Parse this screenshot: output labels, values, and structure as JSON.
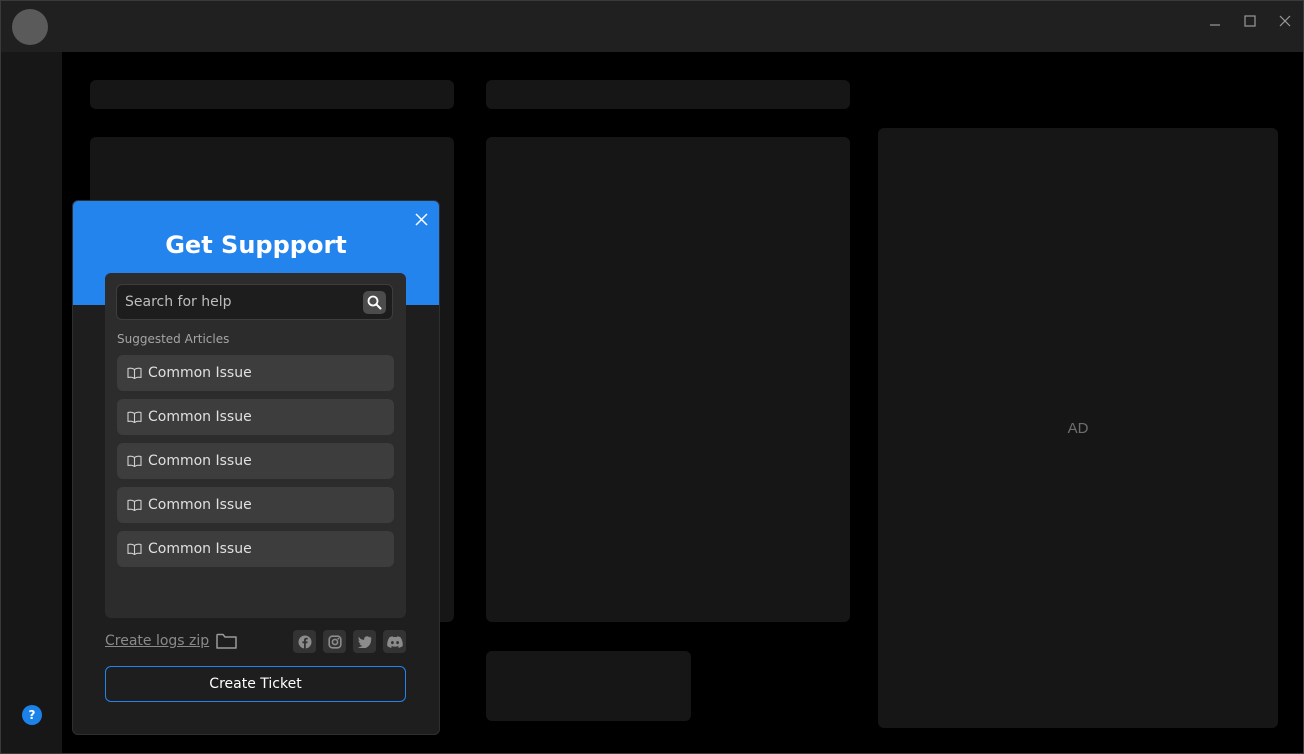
{
  "ad": {
    "label": "AD"
  },
  "help": {
    "symbol": "?"
  },
  "modal": {
    "title": "Get Suppport",
    "search": {
      "placeholder": "Search for help"
    },
    "suggested_label": "Suggested Articles",
    "articles": [
      {
        "label": "Common Issue"
      },
      {
        "label": "Common Issue"
      },
      {
        "label": "Common Issue"
      },
      {
        "label": "Common Issue"
      },
      {
        "label": "Common Issue"
      }
    ],
    "logs_link": "Create logs zip",
    "social": [
      "facebook-icon",
      "instagram-icon",
      "twitter-icon",
      "discord-icon"
    ],
    "create_ticket": "Create Ticket"
  },
  "colors": {
    "accent": "#2384ee",
    "window_bg": "#000000",
    "titlebar": "#202020",
    "panel": "#2c2c2c"
  }
}
